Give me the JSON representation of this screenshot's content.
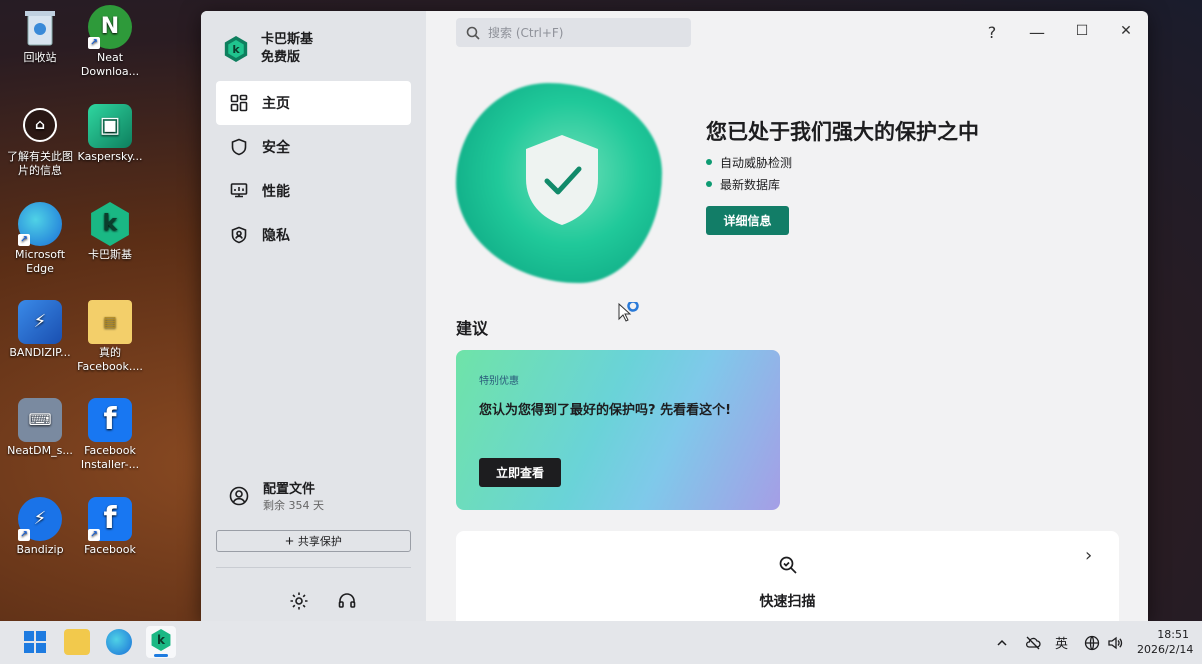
{
  "desktop": {
    "icons": [
      {
        "label": "回收站"
      },
      {
        "label": "Neat Downloa..."
      },
      {
        "label": "了解有关此图片的信息"
      },
      {
        "label": "Kaspersky..."
      },
      {
        "label": "Microsoft Edge"
      },
      {
        "label": "卡巴斯基"
      },
      {
        "label": "BANDIZIP..."
      },
      {
        "label": "真的 Facebook...."
      },
      {
        "label": "NeatDM_s..."
      },
      {
        "label": "Facebook Installer-..."
      },
      {
        "label": "Bandizip"
      },
      {
        "label": "Facebook"
      }
    ]
  },
  "app": {
    "brand_line1": "卡巴斯基",
    "brand_line2": "免费版",
    "nav": [
      {
        "label": "主页",
        "icon": "home-grid-icon"
      },
      {
        "label": "安全",
        "icon": "shield-icon"
      },
      {
        "label": "性能",
        "icon": "performance-icon"
      },
      {
        "label": "隐私",
        "icon": "privacy-icon"
      }
    ],
    "profile_title": "配置文件",
    "profile_sub": "剩余 354 天",
    "share_label": "共享保护",
    "search_placeholder": "搜索 (Ctrl+F)",
    "window_controls": {
      "help": "?",
      "minimize": "—",
      "maximize": "☐",
      "close": "✕"
    },
    "hero_title": "您已处于我们强大的保护之中",
    "hero_bullets": [
      "自动威胁检测",
      "最新数据库"
    ],
    "detail_button": "详细信息",
    "section_title": "建议",
    "promo": {
      "tag": "特别优惠",
      "text": "您认为您得到了最好的保护吗? 先看看这个!",
      "button": "立即查看"
    },
    "scan_label": "快速扫描",
    "accent": "#127d67"
  },
  "taskbar": {
    "tray_lang": "英",
    "time": "18:51",
    "date": "2026/2/14"
  }
}
